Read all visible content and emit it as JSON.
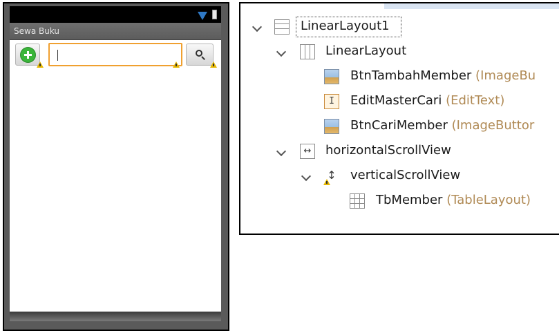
{
  "phone": {
    "app_title": "Sewa Buku",
    "search_input": {
      "value": "",
      "placeholder": ""
    }
  },
  "outline": {
    "nodes": [
      {
        "name": "LinearLayout1",
        "type": "",
        "icon": "linearlayout-vertical-icon"
      },
      {
        "name": "LinearLayout",
        "type": "",
        "icon": "linearlayout-horizontal-icon"
      },
      {
        "name": "BtnTambahMember",
        "type": "(ImageBu",
        "icon": "imagebutton-icon"
      },
      {
        "name": "EditMasterCari",
        "type": "(EditText)",
        "icon": "edittext-icon"
      },
      {
        "name": "BtnCariMember",
        "type": "(ImageButtor",
        "icon": "imagebutton-icon"
      },
      {
        "name": "horizontalScrollView",
        "type": "",
        "icon": "horizontalscrollview-icon"
      },
      {
        "name": "verticalScrollView",
        "type": "",
        "icon": "verticalscrollview-icon"
      },
      {
        "name": "TbMember",
        "type": "(TableLayout)",
        "icon": "tablelayout-icon"
      }
    ]
  },
  "colors": {
    "edit_focus_border": "#f0a030",
    "add_icon_green": "#3ab53a",
    "type_text": "#b08a55",
    "warning": "#e6b800"
  }
}
